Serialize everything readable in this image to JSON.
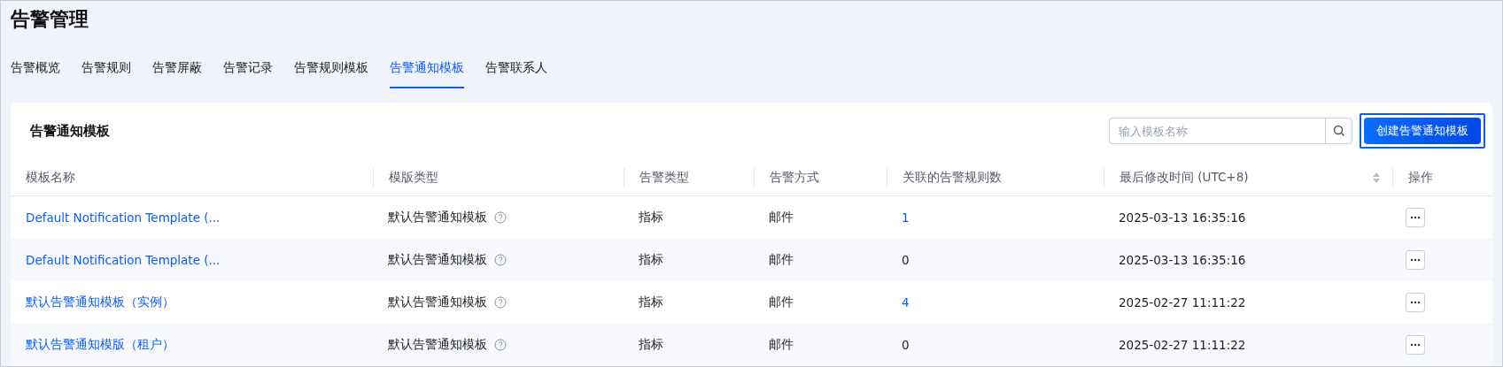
{
  "page_title": "告警管理",
  "tabs": [
    {
      "label": "告警概览",
      "selected": false
    },
    {
      "label": "告警规则",
      "selected": false
    },
    {
      "label": "告警屏蔽",
      "selected": false
    },
    {
      "label": "告警记录",
      "selected": false
    },
    {
      "label": "告警规则模板",
      "selected": false
    },
    {
      "label": "告警通知模板",
      "selected": true
    },
    {
      "label": "告警联系人",
      "selected": false
    }
  ],
  "card": {
    "title": "告警通知模板",
    "search": {
      "placeholder": "输入模板名称"
    },
    "create_button": {
      "label": "创建告警通知模板",
      "focused": true
    }
  },
  "table": {
    "columns": [
      {
        "label": "模板名称",
        "sortable": false
      },
      {
        "label": "模版类型",
        "sortable": false
      },
      {
        "label": "告警类型",
        "sortable": false
      },
      {
        "label": "告警方式",
        "sortable": false
      },
      {
        "label": "关联的告警规则数",
        "sortable": false
      },
      {
        "label": "最后修改时间 (UTC+8)",
        "sortable": true
      },
      {
        "label": "操作",
        "sortable": false
      }
    ],
    "rows": [
      {
        "name": "Default Notification Template (...",
        "template_type": "默认告警通知模板",
        "alarm_type": "指标",
        "method": "邮件",
        "rule_count": "1",
        "rule_count_linked": true,
        "modified": "2025-03-13 16:35:16"
      },
      {
        "name": "Default Notification Template (...",
        "template_type": "默认告警通知模板",
        "alarm_type": "指标",
        "method": "邮件",
        "rule_count": "0",
        "rule_count_linked": false,
        "modified": "2025-03-13 16:35:16"
      },
      {
        "name": "默认告警通知模板（实例）",
        "template_type": "默认告警通知模板",
        "alarm_type": "指标",
        "method": "邮件",
        "rule_count": "4",
        "rule_count_linked": true,
        "modified": "2025-02-27 11:11:22"
      },
      {
        "name": "默认告警通知模版（租户）",
        "template_type": "默认告警通知模板",
        "alarm_type": "指标",
        "method": "邮件",
        "rule_count": "0",
        "rule_count_linked": false,
        "modified": "2025-02-27 11:11:22"
      }
    ]
  }
}
